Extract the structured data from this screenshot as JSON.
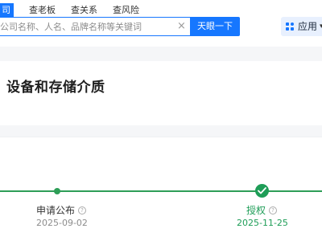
{
  "header": {
    "tabs": [
      {
        "label": "司",
        "active": true
      },
      {
        "label": "查老板"
      },
      {
        "label": "查关系"
      },
      {
        "label": "查风险"
      }
    ],
    "search": {
      "placeholder": "公司名称、人名、品牌名称等关键词",
      "button_label": "天眼一下",
      "clear_icon": "close-icon"
    },
    "apps_label": "应用"
  },
  "page": {
    "title": "设备和存储介质"
  },
  "timeline": {
    "steps": [
      {
        "label": "申请公布",
        "date": "2025-09-02",
        "state": "done"
      },
      {
        "label": "授权",
        "date": "2025-11-25",
        "state": "current"
      }
    ]
  },
  "colors": {
    "brand_blue": "#1677ff",
    "success_green": "#1e9d57"
  }
}
